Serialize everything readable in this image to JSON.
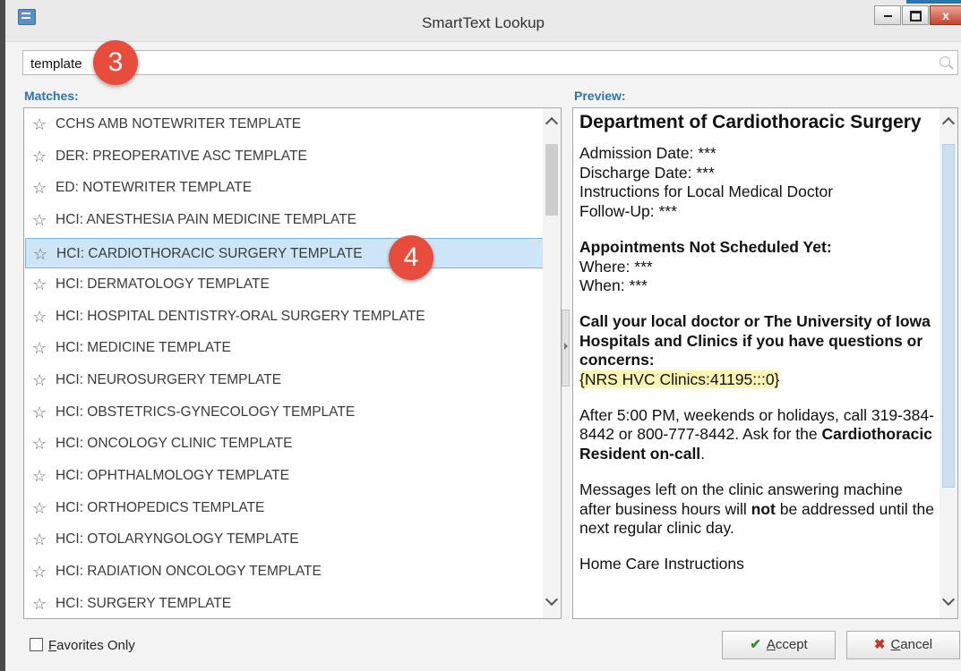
{
  "window": {
    "title": "SmartText Lookup",
    "minimize_label": "",
    "close_label": "x"
  },
  "search": {
    "value": "template",
    "step_badge": "3"
  },
  "matches": {
    "label": "Matches:",
    "items": [
      "CCHS AMB NOTEWRITER TEMPLATE",
      "DER: PREOPERATIVE ASC TEMPLATE",
      "ED: NOTEWRITER TEMPLATE",
      "HCI:  ANESTHESIA PAIN MEDICINE TEMPLATE",
      "HCI:  CARDIOTHORACIC SURGERY TEMPLATE",
      "HCI:  DERMATOLOGY TEMPLATE",
      "HCI:  HOSPITAL DENTISTRY-ORAL SURGERY TEMPLATE",
      "HCI:  MEDICINE TEMPLATE",
      "HCI:  NEUROSURGERY TEMPLATE",
      "HCI:  OBSTETRICS-GYNECOLOGY TEMPLATE",
      "HCI:  ONCOLOGY CLINIC TEMPLATE",
      "HCI:  OPHTHALMOLOGY TEMPLATE",
      "HCI:  ORTHOPEDICS TEMPLATE",
      "HCI:  OTOLARYNGOLOGY TEMPLATE",
      "HCI:  RADIATION ONCOLOGY TEMPLATE",
      "HCI:  SURGERY TEMPLATE"
    ],
    "selected_step_badge": "4"
  },
  "preview": {
    "label": "Preview:",
    "heading": "Department of Cardiothoracic Surgery",
    "admission": "Admission Date: ***",
    "discharge": "Discharge Date: ***",
    "instructions": "Instructions for Local Medical Doctor",
    "followup": "Follow-Up: ***",
    "appt_heading": "Appointments Not Scheduled Yet:",
    "where": "Where: ***",
    "when": "When: ***",
    "call_text": "Call your local doctor or The University of Iowa Hospitals and Clinics if you have questions or concerns:",
    "smartlink": "{NRS HVC Clinics:41195:::0}",
    "after_hours": "After 5:00 PM, weekends or holidays, call 319-384-8442 or 800-777-8442. Ask for the",
    "resident": "Cardiothoracic Resident on-call",
    "period": ".",
    "messages_a": "Messages left on the clinic answering machine after business hours will",
    "messages_not": "not",
    "messages_b": "be addressed until the next regular clinic day.",
    "home_care": "Home Care Instructions"
  },
  "footer": {
    "favorites_pre": "",
    "favorites_u": "F",
    "favorites_rest": "avorites Only",
    "accept_u": "A",
    "accept_rest": "ccept",
    "cancel_u": "C",
    "cancel_rest": "ancel"
  },
  "icons": {
    "star": "☆",
    "check": "✔",
    "x": "✖"
  }
}
